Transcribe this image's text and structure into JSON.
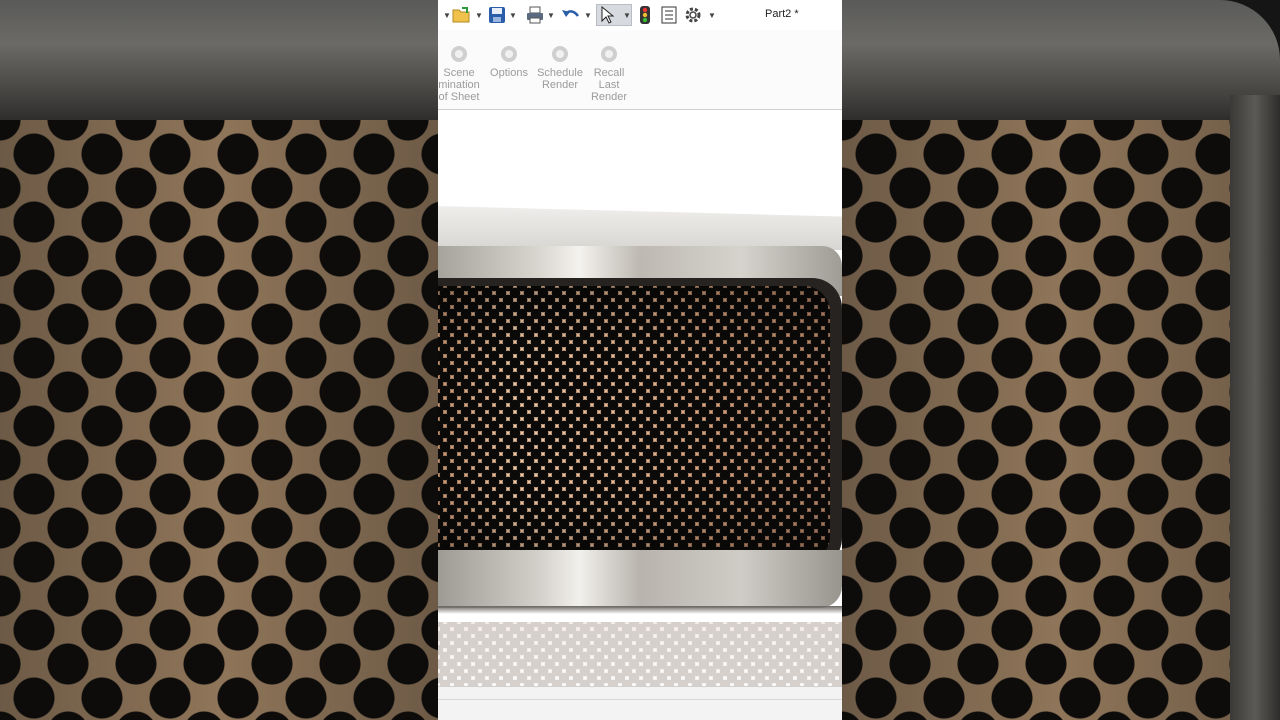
{
  "document": {
    "title": "Part2 *"
  },
  "quick_access_toolbar": {
    "items": [
      {
        "name": "open",
        "icon": "folder-open-icon"
      },
      {
        "name": "save",
        "icon": "save-icon"
      },
      {
        "name": "print",
        "icon": "print-icon"
      },
      {
        "name": "undo",
        "icon": "undo-icon"
      },
      {
        "name": "select",
        "icon": "cursor-arrow-icon",
        "selected": true
      },
      {
        "name": "rebuild",
        "icon": "traffic-light-icon"
      },
      {
        "name": "file-properties",
        "icon": "file-properties-icon"
      },
      {
        "name": "options",
        "icon": "gear-icon"
      }
    ]
  },
  "ribbon": {
    "items": [
      {
        "label": "Scene\nmination\nof Sheet",
        "icon": "scene-illumination-icon"
      },
      {
        "label": "Options",
        "icon": "render-options-icon"
      },
      {
        "label": "Schedule\nRender",
        "icon": "schedule-render-icon"
      },
      {
        "label": "Recall\nLast\nRender",
        "icon": "recall-render-icon"
      }
    ]
  },
  "colors": {
    "accent": "#2a5ea8",
    "disabled_text": "#9b9b9b",
    "mesh_copper": "#e8b995",
    "metal": "#d9d6d0"
  }
}
